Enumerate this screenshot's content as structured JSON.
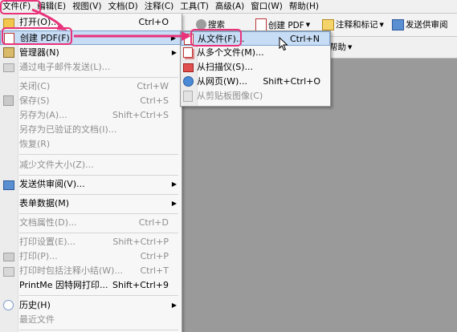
{
  "menubar": [
    {
      "label": "文件(F)"
    },
    {
      "label": "编辑(E)"
    },
    {
      "label": "视图(V)"
    },
    {
      "label": "文档(D)"
    },
    {
      "label": "注释(C)"
    },
    {
      "label": "工具(T)"
    },
    {
      "label": "高级(A)"
    },
    {
      "label": "窗口(W)"
    },
    {
      "label": "帮助(H)"
    }
  ],
  "toolbar": {
    "search": "搜索",
    "create_pdf": "创建 PDF",
    "comment": "注释和标记",
    "send_review": "发送供审阅",
    "help": "帮助"
  },
  "file_menu": {
    "open": {
      "label": "打开(O)...",
      "shortcut": "Ctrl+O"
    },
    "create_pdf": {
      "label": "创建 PDF(F)"
    },
    "organizer": {
      "label": "管理器(N)"
    },
    "email": {
      "label": "通过电子邮件发送(L)..."
    },
    "close": {
      "label": "关闭(C)",
      "shortcut": "Ctrl+W"
    },
    "save": {
      "label": "保存(S)",
      "shortcut": "Ctrl+S"
    },
    "save_as": {
      "label": "另存为(A)...",
      "shortcut": "Shift+Ctrl+S"
    },
    "save_certified": {
      "label": "另存为已验证的文档(I)..."
    },
    "revert": {
      "label": "恢复(R)"
    },
    "reduce": {
      "label": "减少文件大小(Z)..."
    },
    "send_review": {
      "label": "发送供审阅(V)..."
    },
    "form_data": {
      "label": "表单数据(M)"
    },
    "properties": {
      "label": "文档属性(D)...",
      "shortcut": "Ctrl+D"
    },
    "print_setup": {
      "label": "打印设置(E)...",
      "shortcut": "Shift+Ctrl+P"
    },
    "print": {
      "label": "打印(P)...",
      "shortcut": "Ctrl+P"
    },
    "print_comments": {
      "label": "打印时包括注释小结(W)...",
      "shortcut": "Ctrl+T"
    },
    "printme": {
      "label": "PrintMe 因特网打印...",
      "shortcut": "Shift+Ctrl+9"
    },
    "history": {
      "label": "历史(H)"
    },
    "recent": {
      "label": "最近文件"
    }
  },
  "submenu": {
    "from_file": {
      "label": "从文件(F)...",
      "shortcut": "Ctrl+N"
    },
    "from_multiple": {
      "label": "从多个文件(M)..."
    },
    "from_scanner": {
      "label": "从扫描仪(S)..."
    },
    "from_web": {
      "label": "从网页(W)...",
      "shortcut": "Shift+Ctrl+O"
    },
    "from_clipboard": {
      "label": "从剪贴板图像(C)"
    }
  },
  "colors": {
    "highlight": "#c7dcf5",
    "annotation": "#e8327a",
    "menu_bg": "#f7f7f7",
    "workspace": "#9a9a9a"
  }
}
